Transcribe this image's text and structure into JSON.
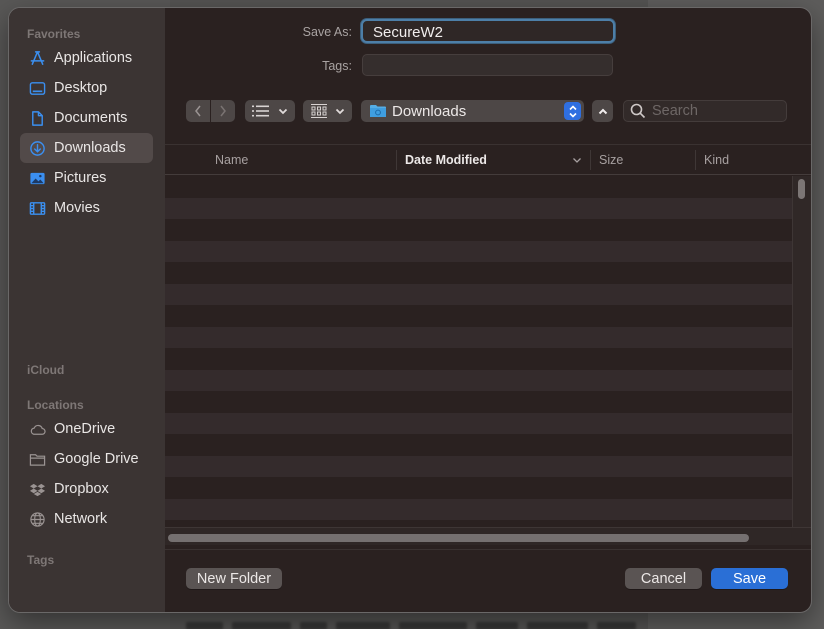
{
  "sidebar": {
    "sections": {
      "favorites": "Favorites",
      "icloud": "iCloud",
      "locations": "Locations",
      "tags": "Tags"
    },
    "favorites": [
      {
        "label": "Applications",
        "icon": "applications-icon"
      },
      {
        "label": "Desktop",
        "icon": "desktop-icon"
      },
      {
        "label": "Documents",
        "icon": "document-icon"
      },
      {
        "label": "Downloads",
        "icon": "downloads-icon",
        "selected": true
      },
      {
        "label": "Pictures",
        "icon": "pictures-icon"
      },
      {
        "label": "Movies",
        "icon": "movies-icon"
      }
    ],
    "locations": [
      {
        "label": "OneDrive",
        "icon": "cloud-icon"
      },
      {
        "label": "Google Drive",
        "icon": "folder-icon"
      },
      {
        "label": "Dropbox",
        "icon": "dropbox-icon"
      },
      {
        "label": "Network",
        "icon": "globe-icon"
      }
    ]
  },
  "form": {
    "save_as_label": "Save As:",
    "save_as_value": "SecureW2",
    "tags_label": "Tags:",
    "tags_value": ""
  },
  "toolbar": {
    "location": "Downloads",
    "search_placeholder": "Search"
  },
  "list": {
    "columns": [
      "Name",
      "Date Modified",
      "Size",
      "Kind"
    ],
    "sorted_column": "Date Modified",
    "rows": []
  },
  "footer": {
    "new_folder": "New Folder",
    "cancel": "Cancel",
    "save": "Save"
  },
  "colors": {
    "accent": "#2a6fd6",
    "sidebar_icon": "#3b8ff0",
    "focus_ring": "#4d7fa8"
  }
}
